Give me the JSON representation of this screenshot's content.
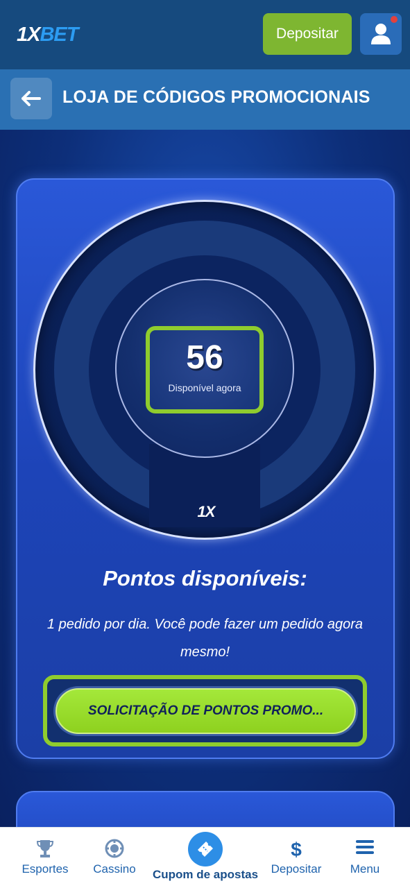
{
  "app": {
    "brand_prefix": "1X",
    "brand_suffix": "BET",
    "deposit_label": "Depositar"
  },
  "header": {
    "title": "LOJA DE CÓDIGOS PROMOCIONAIS"
  },
  "promo": {
    "points_value": "56",
    "points_caption": "Disponível agora",
    "dial_logo": "1X",
    "section_title": "Pontos disponíveis:",
    "description": "1 pedido por dia. Você pode fazer um pedido agora mesmo!",
    "request_button": "SOLICITAÇÃO DE PONTOS PROMO..."
  },
  "bottom_nav": {
    "items": [
      {
        "label": "Esportes",
        "icon": "trophy-icon"
      },
      {
        "label": "Cassino",
        "icon": "casino-chip-icon"
      },
      {
        "label": "Cupom de apostas",
        "icon": "ticket-icon"
      },
      {
        "label": "Depositar",
        "icon": "dollar-icon"
      },
      {
        "label": "Menu",
        "icon": "menu-icon"
      }
    ]
  },
  "colors": {
    "topbar": "#164a7e",
    "header": "#2a70b3",
    "accent_green": "#8fcc2e",
    "nav_blue": "#1f63ad"
  }
}
